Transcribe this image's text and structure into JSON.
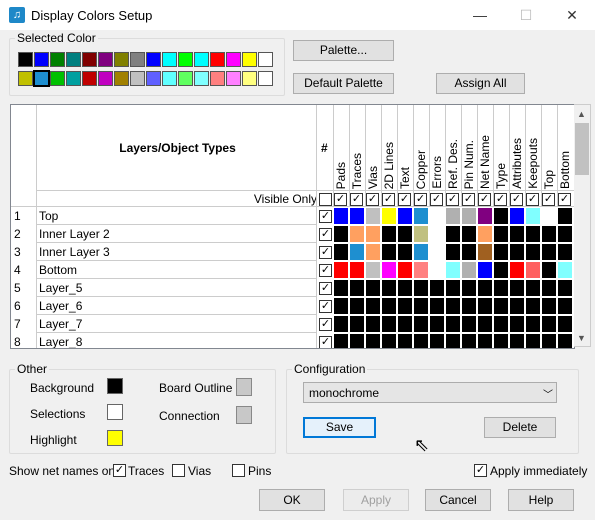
{
  "window": {
    "title": "Display Colors Setup",
    "controls": {
      "minimize": "—",
      "maximize": "☐",
      "close": "✕"
    }
  },
  "selected_color": {
    "label": "Selected Color",
    "row1": [
      "#000000",
      "#0000ff",
      "#008000",
      "#008080",
      "#800000",
      "#800080",
      "#808000",
      "#808080",
      "#0000ff",
      "#00ffff",
      "#00ff00",
      "#00ffff",
      "#ff0000",
      "#ff00ff",
      "#ffff00",
      "#ffffff"
    ],
    "row2": [
      "#c0c000",
      "#1e8fd0",
      "#00c000",
      "#00a0a0",
      "#c00000",
      "#c000c0",
      "#a08000",
      "#c0c0c0",
      "#6060ff",
      "#60ffff",
      "#60ff60",
      "#80ffff",
      "#ff8080",
      "#ff80ff",
      "#ffff80",
      "#ffffff"
    ],
    "selected_index_row2": 1
  },
  "buttons": {
    "palette": "Palette...",
    "default_palette": "Default Palette",
    "assign_all": "Assign All",
    "save": "Save",
    "delete": "Delete",
    "ok": "OK",
    "apply": "Apply",
    "cancel": "Cancel",
    "help": "Help"
  },
  "grid": {
    "header_title": "Layers/Object Types",
    "hash": "#",
    "visible_only": "Visible Only",
    "columns": [
      "Pads",
      "Traces",
      "Vias",
      "2D Lines",
      "Text",
      "Copper",
      "Errors",
      "Ref. Des.",
      "Pin Num.",
      "Net Name",
      "Type",
      "Attributes",
      "Keepouts",
      "Top",
      "Bottom"
    ],
    "rows": [
      {
        "num": "1",
        "name": "Top",
        "checked": true,
        "colors": [
          "#0000ff",
          "#0000ff",
          "#c0c0c0",
          "#ffff00",
          "#0000ff",
          "#1e8fd0",
          "#ffffff",
          "#b0b0b0",
          "#b0b0b0",
          "#800080",
          "#000000",
          "#0000ff",
          "#80ffff",
          "#ffffff",
          "#000000"
        ]
      },
      {
        "num": "2",
        "name": "Inner Layer 2",
        "checked": true,
        "colors": [
          "#000000",
          "#ffa060",
          "#ffa060",
          "#000000",
          "#000000",
          "#c0c080",
          "#ffffff",
          "#000000",
          "#000000",
          "#ffa060",
          "#000000",
          "#000000",
          "#000000",
          "#000000",
          "#000000"
        ]
      },
      {
        "num": "3",
        "name": "Inner Layer 3",
        "checked": true,
        "colors": [
          "#000000",
          "#1e8fd0",
          "#ffa060",
          "#000000",
          "#000000",
          "#1e8fd0",
          "#ffffff",
          "#000000",
          "#000000",
          "#a06020",
          "#000000",
          "#000000",
          "#000000",
          "#000000",
          "#000000"
        ]
      },
      {
        "num": "4",
        "name": "Bottom",
        "checked": true,
        "colors": [
          "#ff0000",
          "#ff0000",
          "#c0c0c0",
          "#ff00ff",
          "#ff0000",
          "#ff8080",
          "#ffffff",
          "#80ffff",
          "#b0b0b0",
          "#0000ff",
          "#000000",
          "#ff0000",
          "#ff6060",
          "#000000",
          "#80ffff"
        ]
      },
      {
        "num": "5",
        "name": "Layer_5",
        "checked": true,
        "colors": [
          "#000000",
          "#000000",
          "#000000",
          "#000000",
          "#000000",
          "#000000",
          "#000000",
          "#000000",
          "#000000",
          "#000000",
          "#000000",
          "#000000",
          "#000000",
          "#000000",
          "#000000"
        ]
      },
      {
        "num": "6",
        "name": "Layer_6",
        "checked": true,
        "colors": [
          "#000000",
          "#000000",
          "#000000",
          "#000000",
          "#000000",
          "#000000",
          "#000000",
          "#000000",
          "#000000",
          "#000000",
          "#000000",
          "#000000",
          "#000000",
          "#000000",
          "#000000"
        ]
      },
      {
        "num": "7",
        "name": "Layer_7",
        "checked": true,
        "colors": [
          "#000000",
          "#000000",
          "#000000",
          "#000000",
          "#000000",
          "#000000",
          "#000000",
          "#000000",
          "#000000",
          "#000000",
          "#000000",
          "#000000",
          "#000000",
          "#000000",
          "#000000"
        ]
      },
      {
        "num": "8",
        "name": "Layer_8",
        "checked": true,
        "colors": [
          "#000000",
          "#000000",
          "#000000",
          "#000000",
          "#000000",
          "#000000",
          "#000000",
          "#000000",
          "#000000",
          "#000000",
          "#000000",
          "#000000",
          "#000000",
          "#000000",
          "#000000"
        ]
      }
    ]
  },
  "other": {
    "label": "Other",
    "background": {
      "label": "Background",
      "color": "#000000"
    },
    "selections": {
      "label": "Selections",
      "color": "#ffffff"
    },
    "highlight": {
      "label": "Highlight",
      "color": "#ffff00"
    },
    "board_outline": {
      "label": "Board Outline",
      "color": "#c8c8c8"
    },
    "connection": {
      "label": "Connection",
      "color": "#c8c8c8"
    }
  },
  "configuration": {
    "label": "Configuration",
    "selected": "monochrome"
  },
  "net_names": {
    "label": "Show net names on",
    "traces": "Traces",
    "vias": "Vias",
    "pins": "Pins",
    "traces_checked": true,
    "vias_checked": false,
    "pins_checked": false
  },
  "apply_immediately": {
    "label": "Apply immediately",
    "checked": true
  }
}
